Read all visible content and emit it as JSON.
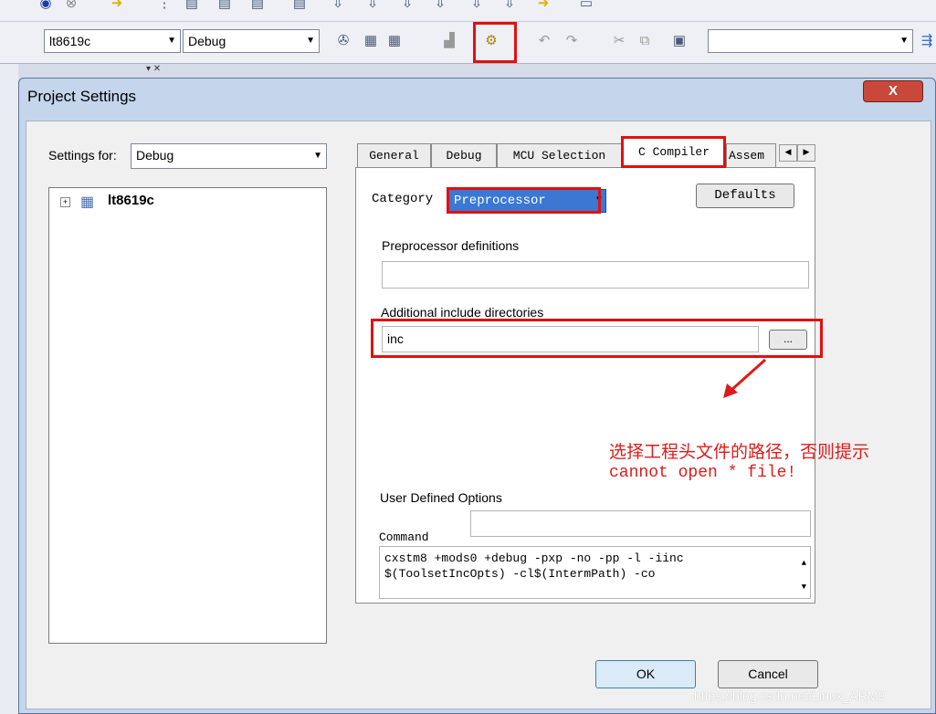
{
  "toolbar": {
    "workspace_combo": "lt8619c",
    "config_combo": "Debug",
    "search_combo": ""
  },
  "dialog": {
    "title": "Project Settings",
    "close_label": "X",
    "settings_for_label": "Settings for:",
    "settings_for_value": "Debug",
    "tree_root": "lt8619c",
    "tabs": [
      "General",
      "Debug",
      "MCU Selection",
      "C Compiler",
      "Assem"
    ],
    "active_tab": "C Compiler",
    "category_label": "Category",
    "category_value": "Preprocessor",
    "defaults_button": "Defaults",
    "preprocessor_label": "Preprocessor definitions",
    "preprocessor_value": "",
    "include_label": "Additional include directories",
    "include_value": "inc",
    "browse_button": "...",
    "user_options_label": "User Defined Options",
    "user_options_value": "",
    "command_label": "Command",
    "command_line1": "cxstm8 +mods0 +debug -pxp -no -pp -l -iinc",
    "command_line2": "$(ToolsetIncOpts) -cl$(IntermPath) -co",
    "ok_button": "OK",
    "cancel_button": "Cancel"
  },
  "annotation": {
    "line1": "选择工程头文件的路径，否则提示",
    "line2": "cannot open * file!",
    "color": "#e01a1a"
  },
  "watermark": "https://blog.csdn.net/Linux_ARM9"
}
